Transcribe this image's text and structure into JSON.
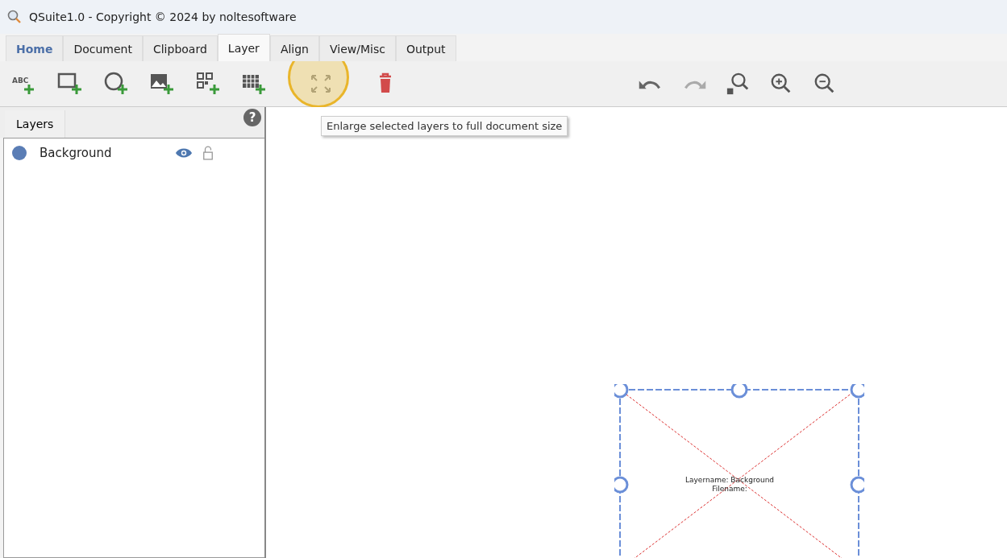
{
  "window": {
    "title": "QSuite1.0 - Copyright © 2024 by noltesoftware"
  },
  "tabs": [
    {
      "label": "Home",
      "selected": false,
      "kind": "home"
    },
    {
      "label": "Document",
      "selected": false,
      "kind": "tab"
    },
    {
      "label": "Clipboard",
      "selected": false,
      "kind": "tab"
    },
    {
      "label": "Layer",
      "selected": true,
      "kind": "tab"
    },
    {
      "label": "Align",
      "selected": false,
      "kind": "tab"
    },
    {
      "label": "View/Misc",
      "selected": false,
      "kind": "tab"
    },
    {
      "label": "Output",
      "selected": false,
      "kind": "tab"
    }
  ],
  "toolbar": {
    "text_icon": "ABC",
    "tooltip": "Enlarge selected layers to full document size"
  },
  "layers_panel": {
    "tab": "Layers",
    "help": "?",
    "items": [
      {
        "name": "Background",
        "color": "#5a7db5",
        "visible": true,
        "locked": false
      }
    ]
  },
  "canvas": {
    "layer_label": "Layername: Background",
    "file_label": "Filename:"
  }
}
